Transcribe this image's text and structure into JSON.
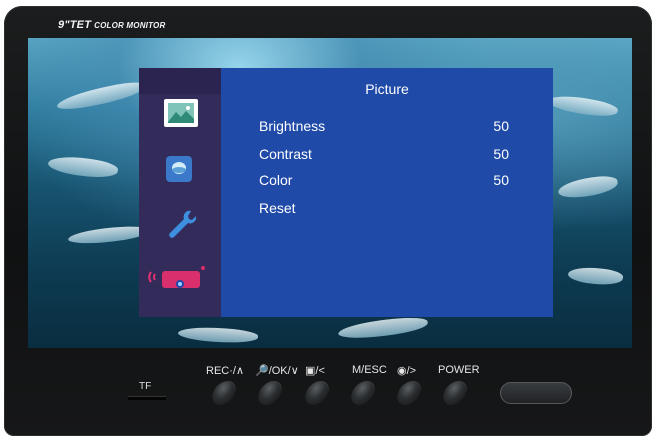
{
  "device": {
    "brand_title": "9\"TET",
    "brand_subtitle": "COLOR MONITOR"
  },
  "osd": {
    "title": "Picture",
    "items": [
      {
        "label": "Brightness",
        "value": "50"
      },
      {
        "label": "Contrast",
        "value": "50"
      },
      {
        "label": "Color",
        "value": "50"
      },
      {
        "label": "Reset",
        "value": ""
      }
    ],
    "tabs": [
      {
        "name": "picture-tab",
        "icon": "landscape-icon",
        "selected": true
      },
      {
        "name": "display-tab",
        "icon": "circle-screen-icon",
        "selected": false
      },
      {
        "name": "settings-tab",
        "icon": "wrench-icon",
        "selected": false
      },
      {
        "name": "camera-tab",
        "icon": "camera-signal-icon",
        "selected": false
      }
    ]
  },
  "panel": {
    "tf_label": "TF",
    "buttons": [
      {
        "label": "REC·/∧"
      },
      {
        "label": "🔎/OK/∨"
      },
      {
        "label": "▣/<"
      },
      {
        "label": "M/ESC"
      },
      {
        "label": "◉/>"
      },
      {
        "label": "POWER"
      }
    ]
  },
  "colors": {
    "osd_main_bg": "#1f4aa7",
    "osd_side_bg": "#332b5a",
    "bezel": "#111213"
  }
}
